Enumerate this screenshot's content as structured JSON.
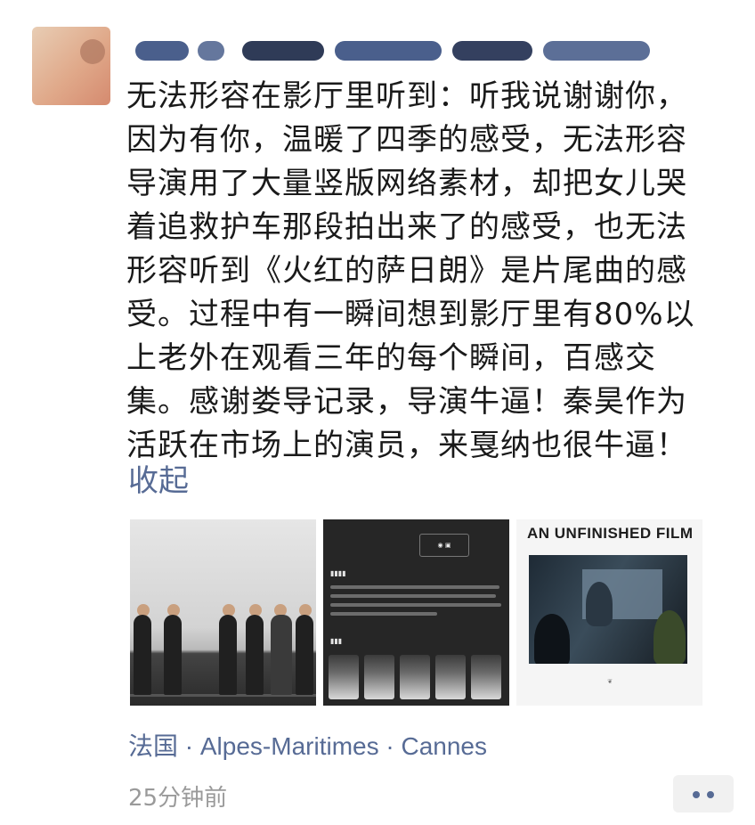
{
  "post": {
    "body_lines": [
      "无法形容在影厅里听到：听我说谢谢你，",
      "因为有你，温暖了四季的感受，无法形容",
      "导演用了大量竖版网络素材，却把女儿哭",
      "着追救护车那段拍出来了的感受，也无法",
      "形容听到《火红的萨日朗》是片尾曲的感",
      "受。过程中有一瞬间想到影厅里有80%以",
      "上老外在观看三年的每个瞬间，百感交",
      "集。感谢娄导记录，导演牛逼！秦昊作为",
      "活跃在市场上的演员，来戛纳也很牛逼！"
    ],
    "collapse_label": "收起",
    "photo3_title": "AN UNFINISHED FILM",
    "location": "法国 · Alpes-Maritimes · Cannes",
    "timestamp": "25分钟前"
  },
  "colors": {
    "link": "#576b95",
    "text": "#1a1a1a",
    "meta": "#9a9a9a"
  },
  "icons": {
    "more": "two-dots-icon"
  }
}
